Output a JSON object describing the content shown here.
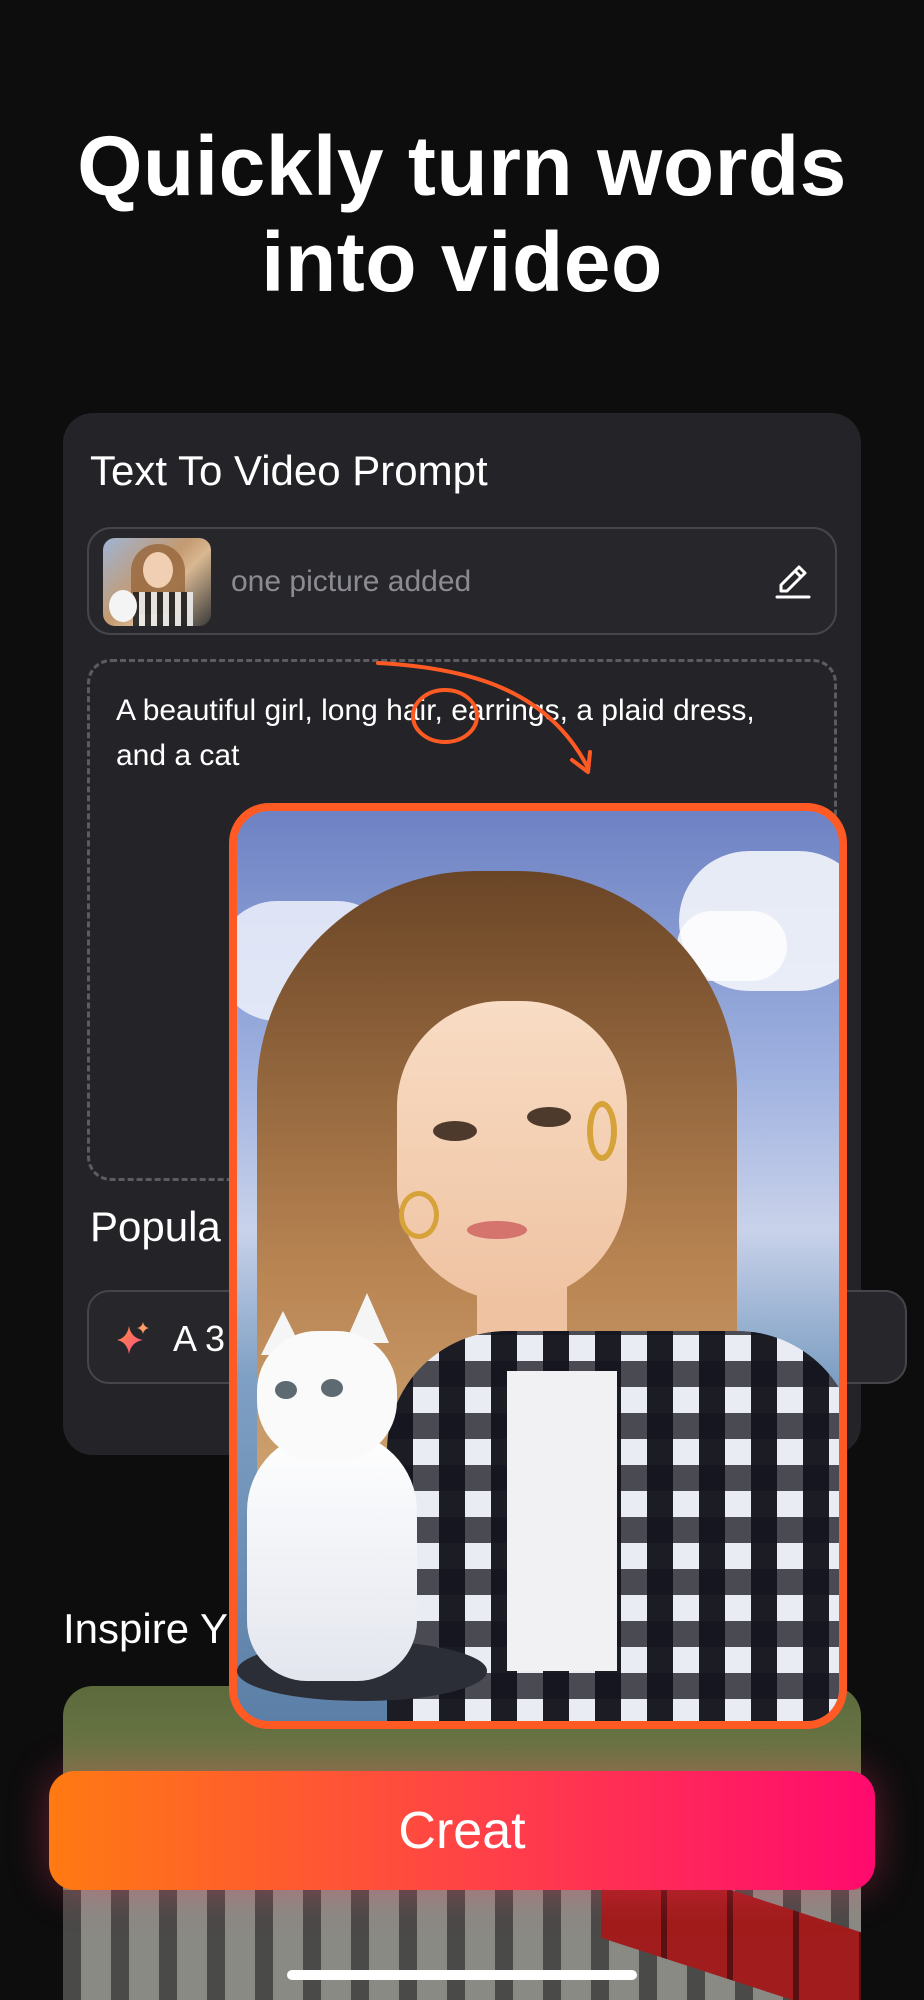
{
  "hero": {
    "title_line1": "Quickly turn words",
    "title_line2": "into video"
  },
  "prompt_card": {
    "title": "Text To Video Prompt",
    "picture_label": "one picture added",
    "prompt_text": "A beautiful girl, long hair, earrings, a plaid dress, and a cat",
    "popular_label": "Popula",
    "chip_text": "A 3"
  },
  "inspire": {
    "label": "Inspire Y"
  },
  "actions": {
    "create_label": "Creat"
  },
  "colors": {
    "accent": "#ff5a24",
    "card": "#242428",
    "button_start": "#ff7a12",
    "button_end": "#ff0a6e"
  },
  "icons": {
    "edit": "pencil-icon",
    "chip": "sparkle-icon"
  }
}
